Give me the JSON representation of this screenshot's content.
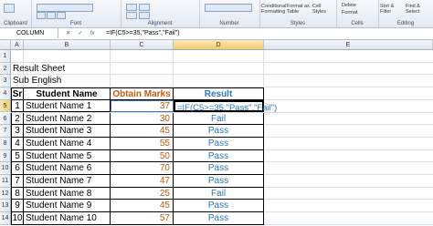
{
  "ribbon": {
    "clipboard_label": "Clipboard",
    "font_label": "Font",
    "alignment_label": "Alignment",
    "number_label": "Number",
    "styles_label": "Styles",
    "cells_label": "Cells",
    "editing_label": "Editing",
    "conditional_formatting": "Conditional Formatting",
    "format_as_table": "Format as Table",
    "cell_styles": "Cell Styles",
    "delete_label": "Delete",
    "format_label": "Format",
    "sort_filter": "Sort & Filter",
    "find_select": "Find & Select"
  },
  "formula_bar": {
    "name_box": "COLUMN",
    "fx": "fx",
    "formula": "=IF(C5>=35,\"Pass\",\"Fail\")"
  },
  "columns": [
    "A",
    "B",
    "C",
    "D",
    "E"
  ],
  "row_numbers": [
    "1",
    "2",
    "3",
    "4",
    "5",
    "6",
    "7",
    "8",
    "9",
    "10",
    "11",
    "12",
    "13",
    "14"
  ],
  "sheet": {
    "title": "Result Sheet",
    "subject": "Sub English",
    "headers": {
      "sr": "Sr",
      "name": "Student Name",
      "marks": "Obtain Marks",
      "result": "Result"
    },
    "editing_formula": "=IF(C5>=35,\"Pass\",\"Fail\")",
    "rows": [
      {
        "sr": "1",
        "name": "Student Name 1",
        "marks": "37",
        "result": ""
      },
      {
        "sr": "2",
        "name": "Student Name 2",
        "marks": "30",
        "result": "Fail"
      },
      {
        "sr": "3",
        "name": "Student Name 3",
        "marks": "45",
        "result": "Pass"
      },
      {
        "sr": "4",
        "name": "Student Name 4",
        "marks": "55",
        "result": "Pass"
      },
      {
        "sr": "5",
        "name": "Student Name 5",
        "marks": "50",
        "result": "Pass"
      },
      {
        "sr": "6",
        "name": "Student Name 6",
        "marks": "70",
        "result": "Pass"
      },
      {
        "sr": "7",
        "name": "Student Name 7",
        "marks": "47",
        "result": "Pass"
      },
      {
        "sr": "8",
        "name": "Student Name 8",
        "marks": "25",
        "result": "Fail"
      },
      {
        "sr": "9",
        "name": "Student Name 9",
        "marks": "45",
        "result": "Pass"
      },
      {
        "sr": "10",
        "name": "Student Name 10",
        "marks": "57",
        "result": "Pass"
      }
    ]
  },
  "colors": {
    "marks": "#c55a11",
    "result": "#2e75b6",
    "selected_header": "#f3c970"
  }
}
